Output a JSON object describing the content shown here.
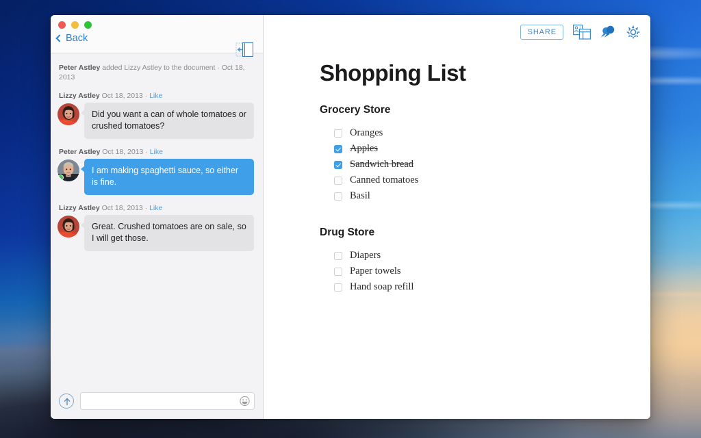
{
  "window": {
    "traffic_lights": [
      "close",
      "minimize",
      "zoom"
    ],
    "back_label": "Back"
  },
  "comments": {
    "system_event": {
      "actor": "Peter Astley",
      "text": " added Lizzy Astley to the document · Oct 18, 2013"
    },
    "messages": [
      {
        "author": "Lizzy Astley",
        "meta": " Oct 18, 2013 · ",
        "like_label": "Like",
        "text": "Did you want a can of whole tomatoes or crushed tomatoes?",
        "side": "them",
        "online": false
      },
      {
        "author": "Peter Astley",
        "meta": " Oct 18, 2013 · ",
        "like_label": "Like",
        "text": "I am making spaghetti sauce, so either is fine.",
        "side": "me",
        "online": true
      },
      {
        "author": "Lizzy Astley",
        "meta": " Oct 18, 2013 · ",
        "like_label": "Like",
        "text": "Great. Crushed tomatoes are on sale, so I will get those.",
        "side": "them",
        "online": false
      }
    ],
    "composer": {
      "value": "",
      "placeholder": ""
    }
  },
  "toolbar": {
    "share_label": "SHARE",
    "icons": [
      "comments-panel-icon",
      "pin-icon",
      "gear-icon"
    ]
  },
  "document": {
    "title": "Shopping List",
    "sections": [
      {
        "heading": "Grocery Store",
        "items": [
          {
            "label": "Oranges",
            "checked": false
          },
          {
            "label": "Apples",
            "checked": true
          },
          {
            "label": "Sandwich bread",
            "checked": true
          },
          {
            "label": "Canned tomatoes",
            "checked": false
          },
          {
            "label": "Basil",
            "checked": false
          }
        ]
      },
      {
        "heading": "Drug Store",
        "items": [
          {
            "label": "Diapers",
            "checked": false
          },
          {
            "label": "Paper towels",
            "checked": false
          },
          {
            "label": "Hand soap refill",
            "checked": false
          }
        ]
      }
    ]
  },
  "colors": {
    "accent_blue": "#3f9fe8",
    "link_blue": "#2c7fcb",
    "icon_blue": "#3c87c8",
    "bubble_grey": "#e3e3e6",
    "online_green": "#3fc452"
  }
}
